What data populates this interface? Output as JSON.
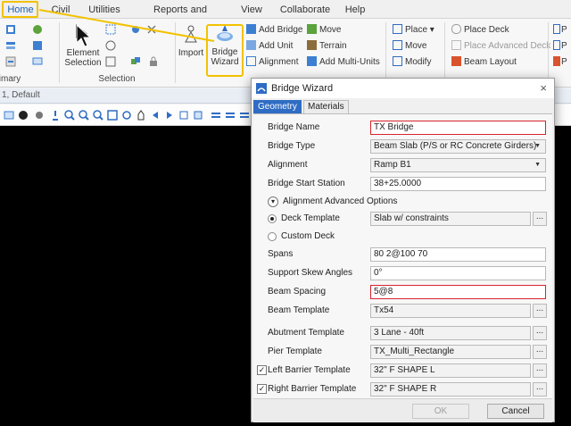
{
  "tabs": [
    "Home",
    "Civil",
    "Utilities",
    "Reports and Drawings",
    "View",
    "Collaborate",
    "Help"
  ],
  "active_tab": "Home",
  "ribbon": {
    "groups": {
      "primary": "imary",
      "selection": "Selection"
    },
    "element_selection": "Element Selection",
    "import": "Import",
    "bridge_wizard": "Bridge Wizard",
    "bridge_col1": [
      "Add Bridge",
      "Add Unit",
      "Alignment"
    ],
    "bridge_col2": [
      "Move",
      "Terrain",
      "Add Multi-Units"
    ],
    "place_col": [
      "Place",
      "Move",
      "Modify"
    ],
    "deck_col": [
      "Place Deck",
      "Place Advanced Deck",
      "Beam Layout"
    ],
    "deck_disabled": [
      false,
      true,
      false
    ],
    "cut_right": [
      "P",
      "P",
      "P"
    ]
  },
  "view": {
    "title": "1, Default"
  },
  "dialog": {
    "title": "Bridge Wizard",
    "close_glyph": "×",
    "tabs": [
      "Geometry",
      "Materials"
    ],
    "labels": {
      "bridge_name": "Bridge Name",
      "bridge_type": "Bridge Type",
      "alignment": "Alignment",
      "start_station": "Bridge Start Station",
      "adv_options": "Alignment Advanced Options",
      "deck_template": "Deck Template",
      "custom_deck": "Custom Deck",
      "spans": "Spans",
      "skew": "Support Skew Angles",
      "beam_spacing": "Beam Spacing",
      "beam_template": "Beam Template",
      "abutment_template": "Abutment Template",
      "pier_template": "Pier Template",
      "left_barrier": "Left Barrier Template",
      "right_barrier": "Right Barrier Template"
    },
    "values": {
      "bridge_name": "TX Bridge",
      "bridge_type": "Beam Slab (P/S or RC Concrete Girders)",
      "alignment": "Ramp B1",
      "start_station": "38+25.0000",
      "deck_template": "Slab w/ constraints",
      "spans": "80 2@100 70",
      "skew": "0°",
      "beam_spacing": "5@8",
      "beam_template": "Tx54",
      "abutment_template": "3 Lane - 40ft",
      "pier_template": "TX_Multi_Rectangle",
      "left_barrier": "32\" F SHAPE L",
      "right_barrier": "32\" F SHAPE R"
    },
    "ok": "OK",
    "cancel": "Cancel"
  },
  "colors": {
    "highlight": "#f2c200",
    "accent": "#2f6cc4",
    "error_border": "#d9232d"
  }
}
